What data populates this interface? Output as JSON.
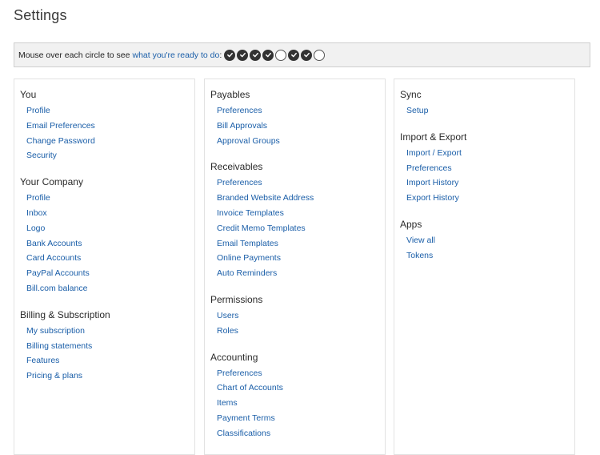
{
  "page": {
    "title": "Settings"
  },
  "readiness": {
    "prefix": "Mouse over each circle to see",
    "link": "what you're ready to do",
    "suffix": ":",
    "circles": [
      {
        "state": "done"
      },
      {
        "state": "done"
      },
      {
        "state": "done"
      },
      {
        "state": "done"
      },
      {
        "state": "todo"
      },
      {
        "state": "done"
      },
      {
        "state": "done"
      },
      {
        "state": "todo"
      }
    ]
  },
  "columns": [
    {
      "sections": [
        {
          "title": "You",
          "links": [
            "Profile",
            "Email Preferences",
            "Change Password",
            "Security"
          ]
        },
        {
          "title": "Your Company",
          "links": [
            "Profile",
            "Inbox",
            "Logo",
            "Bank Accounts",
            "Card Accounts",
            "PayPal Accounts",
            "Bill.com balance"
          ]
        },
        {
          "title": "Billing & Subscription",
          "links": [
            "My subscription",
            "Billing statements",
            "Features",
            "Pricing & plans"
          ]
        }
      ]
    },
    {
      "sections": [
        {
          "title": "Payables",
          "links": [
            "Preferences",
            "Bill Approvals",
            "Approval Groups"
          ]
        },
        {
          "title": "Receivables",
          "links": [
            "Preferences",
            "Branded Website Address",
            "Invoice Templates",
            "Credit Memo Templates",
            "Email Templates",
            "Online Payments",
            "Auto Reminders"
          ]
        },
        {
          "title": "Permissions",
          "links": [
            "Users",
            "Roles"
          ]
        },
        {
          "title": "Accounting",
          "links": [
            "Preferences",
            "Chart of Accounts",
            "Items",
            "Payment Terms",
            "Classifications"
          ]
        }
      ]
    },
    {
      "sections": [
        {
          "title": "Sync",
          "links": [
            "Setup"
          ]
        },
        {
          "title": "Import & Export",
          "links": [
            "Import / Export",
            "Preferences",
            "Import History",
            "Export History"
          ]
        },
        {
          "title": "Apps",
          "links": [
            "View all",
            "Tokens"
          ]
        }
      ]
    }
  ],
  "colors": {
    "link": "#1a5ea8",
    "heading": "#2b2b2b",
    "bar_background": "#f1f1f1",
    "circle_done": "#333333"
  },
  "icons": {
    "circle_done": "check-circle-icon",
    "circle_todo": "empty-circle-icon"
  }
}
